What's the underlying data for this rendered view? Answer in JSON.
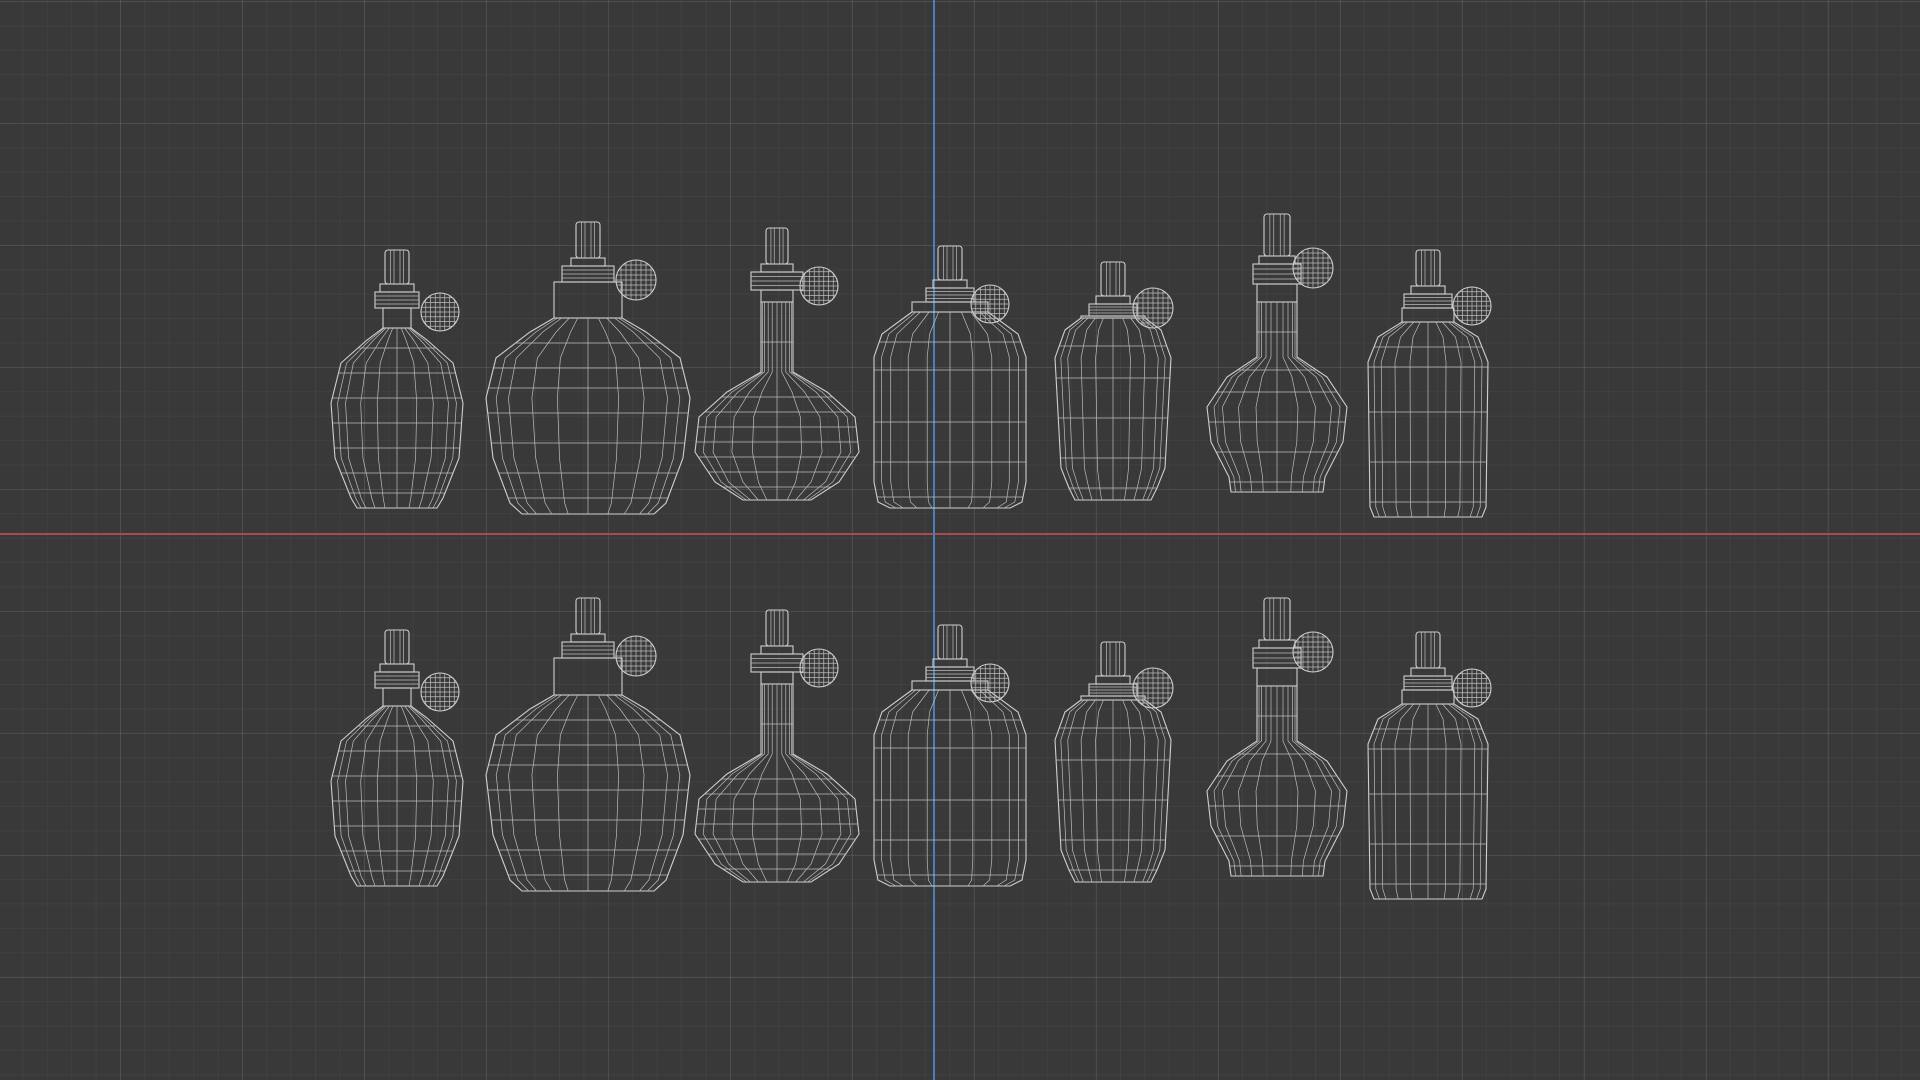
{
  "viewport": {
    "view": "orthographic-front",
    "shading": "wireframe",
    "grid": true,
    "background_color": "#393939",
    "grid_color": "#4a4a4a",
    "axis_colors": {
      "x": "#a84a52",
      "z": "#4a7fb8"
    },
    "wire_color": "#cfcfcf"
  },
  "rows": [
    {
      "name": "row-top",
      "bottles": [
        "bottle-1",
        "bottle-2",
        "bottle-3",
        "bottle-4",
        "bottle-5",
        "bottle-6",
        "bottle-7"
      ]
    },
    {
      "name": "row-bottom",
      "bottles": [
        "bottle-1",
        "bottle-2",
        "bottle-3",
        "bottle-4",
        "bottle-5",
        "bottle-6",
        "bottle-7"
      ]
    }
  ],
  "bottle_styles": [
    {
      "id": "bottle-1",
      "shape": "oval-grenade",
      "atomizer": true
    },
    {
      "id": "bottle-2",
      "shape": "wide-jar",
      "atomizer": true
    },
    {
      "id": "bottle-3",
      "shape": "round-flask",
      "atomizer": true
    },
    {
      "id": "bottle-4",
      "shape": "rounded-square",
      "atomizer": true
    },
    {
      "id": "bottle-5",
      "shape": "tapered-shaker",
      "atomizer": true
    },
    {
      "id": "bottle-6",
      "shape": "long-neck-decanter",
      "atomizer": true
    },
    {
      "id": "bottle-7",
      "shape": "tall-rectangular",
      "atomizer": true
    }
  ]
}
